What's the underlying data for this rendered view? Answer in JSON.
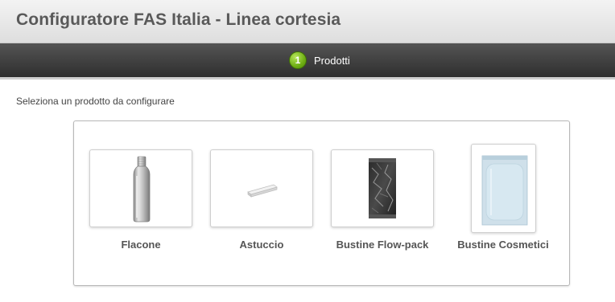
{
  "header": {
    "title": "Configuratore FAS Italia - Linea cortesia"
  },
  "steps": [
    {
      "number": "1",
      "label": "Prodotti"
    }
  ],
  "instruction": "Seleziona un prodotto da configurare",
  "products": [
    {
      "name": "Flacone",
      "icon": "bottle-image"
    },
    {
      "name": "Astuccio",
      "icon": "case-image"
    },
    {
      "name": "Bustine Flow-pack",
      "icon": "flowpack-sachet-image"
    },
    {
      "name": "Bustine Cosmetici",
      "icon": "cosmetic-sachet-image"
    }
  ],
  "colors": {
    "step_active": "#6fae14",
    "stepbar": "#3a3a3a"
  }
}
